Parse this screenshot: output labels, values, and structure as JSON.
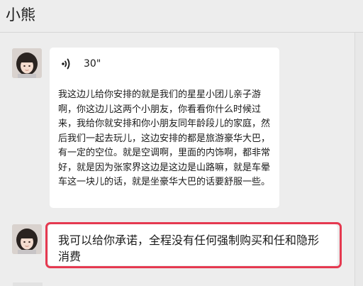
{
  "window": {
    "title": "小熊"
  },
  "messages": [
    {
      "type": "voice",
      "sender_avatar": "girl-portrait-avatar",
      "voice_icon": "voice-wave-icon",
      "duration": "30\"",
      "transcript": "我这边儿给你安排的就是我们的星星小团儿亲子游啊，你这边儿这两个小朋友，你看看你什么时候过来，我给你就安排和你小朋友同年龄段儿的家庭，然后我们一起去玩儿，这边安排的都是旅游豪华大巴，有一定的空位。就是空调啊，里面的内饰啊，都非常好，就是因为张家界这边是这边是山路嘛，就是车晕车这一块儿的话，就是坐豪华大巴的话要舒服一些。"
    },
    {
      "type": "text",
      "sender_avatar": "girl-portrait-avatar",
      "text": "我可以给你承诺，全程没有任何强制购买和任和隐形消费",
      "highlight_color": "#e53950"
    }
  ],
  "colors": {
    "background": "#ededed",
    "bubble": "#ffffff",
    "highlight": "#e53950"
  }
}
